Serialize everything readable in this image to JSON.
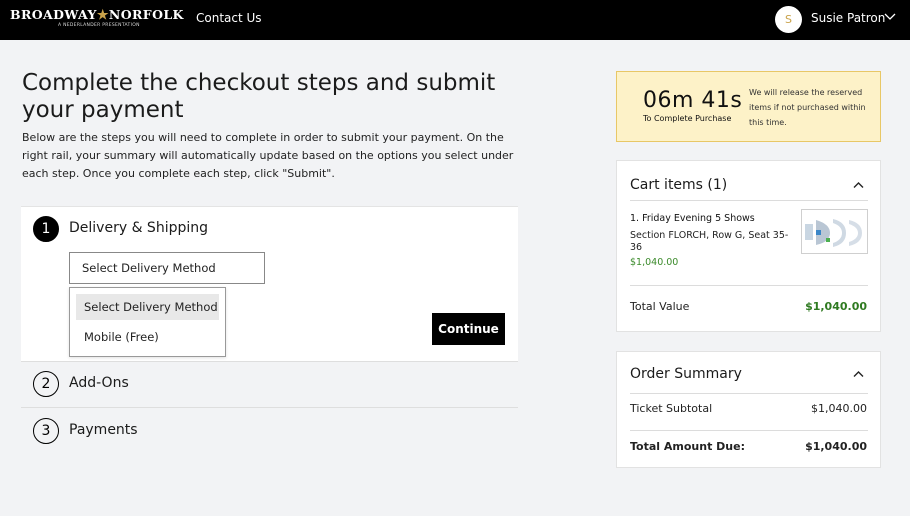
{
  "header": {
    "logo_text_left": "BROADWAY",
    "logo_star": "★",
    "logo_text_right": "NORFOLK",
    "logo_subtext": "A NEDERLANDER PRESENTATION",
    "nav_contact": "Contact Us",
    "user_initial": "S",
    "user_name": "Susie Patron",
    "user_menu_icon": "chevron-down-icon"
  },
  "main": {
    "title": "Complete the checkout steps and submit your payment",
    "description": "Below are the steps you will need to complete in order to submit your payment. On the right rail, your summary will automatically update based on the options you select under each step. Once you complete each step, click \"Submit\".",
    "steps": [
      {
        "number": "1",
        "label": "Delivery & Shipping",
        "active": true
      },
      {
        "number": "2",
        "label": "Add-Ons",
        "active": false
      },
      {
        "number": "3",
        "label": "Payments",
        "active": false
      }
    ],
    "delivery_select": {
      "value": "Select Delivery Method",
      "options": [
        "Select Delivery Method",
        "Mobile (Free)"
      ],
      "highlighted_option": 0
    },
    "continue_label": "Continue"
  },
  "timer": {
    "value": "06m 41s",
    "caption": "To Complete Purchase",
    "note": "We will release the reserved items if not purchased within this time."
  },
  "cart": {
    "title": "Cart items (1)",
    "item_name": "1. Friday Evening 5 Shows",
    "item_detail": "Section FLORCH, Row G, Seat 35-36",
    "item_price": "$1,040.00",
    "total_label": "Total Value",
    "total_value": "$1,040.00",
    "collapse_icon": "chevron-up-icon"
  },
  "order_summary": {
    "title": "Order Summary",
    "subtotal_label": "Ticket Subtotal",
    "subtotal_value": "$1,040.00",
    "due_label": "Total Amount Due:",
    "due_value": "$1,040.00",
    "collapse_icon": "chevron-up-icon"
  },
  "colors": {
    "header_bg": "#000000",
    "accent_gold": "#c9a24a",
    "timer_bg": "#fdf2c8",
    "price_green": "#2f7a21"
  }
}
